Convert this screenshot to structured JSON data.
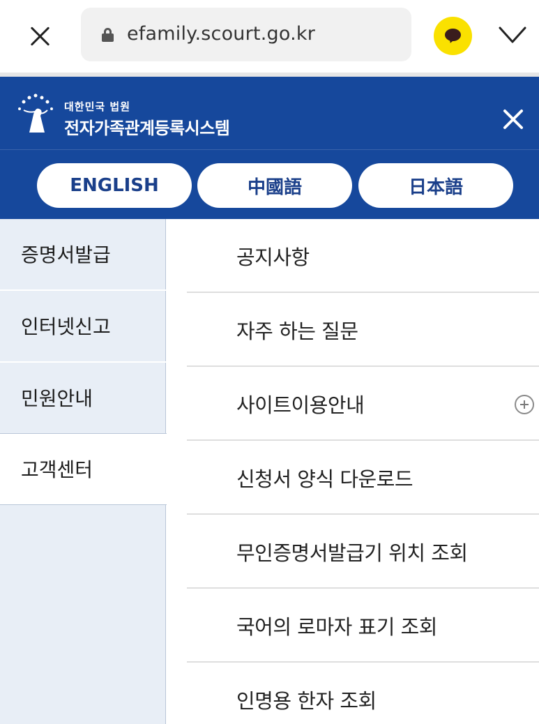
{
  "browser": {
    "url": "efamily.scourt.go.kr",
    "close_icon": "close-icon",
    "lock_icon": "lock-icon",
    "talk_icon": "kakaotalk-icon",
    "menu_icon": "chevron-down-icon"
  },
  "header": {
    "logo_small": "대한민국 법원",
    "logo_title": "전자가족관계등록시스템",
    "close_icon": "close-icon",
    "bg_color": "#16489c",
    "languages": [
      "ENGLISH",
      "中國語",
      "日本語"
    ]
  },
  "menu": {
    "categories": [
      "증명서발급",
      "인터넷신고",
      "민원안내",
      "고객센터"
    ],
    "active_category": "고객센터",
    "items": [
      "공지사항",
      "자주 하는 질문",
      "사이트이용안내",
      "신청서 양식 다운로드",
      "무인증명서발급기 위치 조회",
      "국어의 로마자 표기 조회",
      "인명용 한자 조회"
    ],
    "expandable_item": "사이트이용안내",
    "expand_icon": "plus-circle-icon"
  }
}
